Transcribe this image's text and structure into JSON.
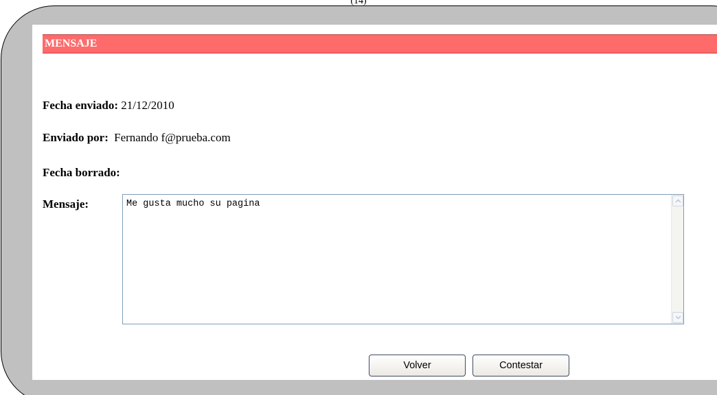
{
  "figure": {
    "caption": "(14)"
  },
  "header": {
    "title": "MENSAJE"
  },
  "fields": {
    "fecha_enviado": {
      "label": "Fecha enviado:",
      "value": "21/12/2010"
    },
    "enviado_por": {
      "label": "Enviado por:",
      "value": "Fernando f@prueba.com"
    },
    "fecha_borrado": {
      "label": "Fecha borrado:",
      "value": ""
    },
    "mensaje": {
      "label": "Mensaje:",
      "value": "Me gusta mucho su pagina"
    }
  },
  "buttons": {
    "volver": "Volver",
    "contestar": "Contestar"
  },
  "colors": {
    "header_bar": "#ff6a6a",
    "frame": "#c0c0c0",
    "textarea_border": "#7f9db9"
  },
  "icons": {
    "scroll_up": "chevron-up-icon",
    "scroll_down": "chevron-down-icon"
  }
}
